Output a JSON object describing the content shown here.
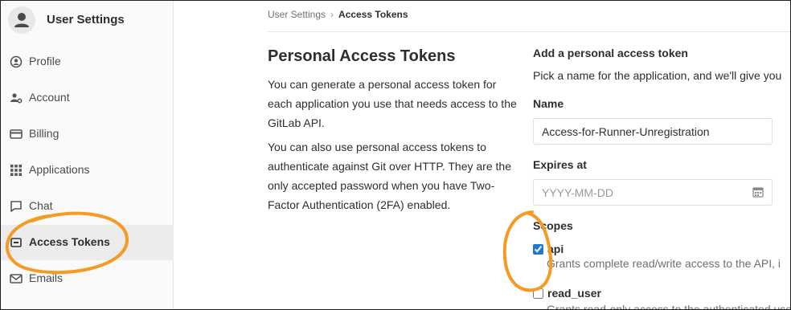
{
  "sidebar": {
    "title": "User Settings",
    "items": [
      {
        "label": "Profile",
        "icon": "user-circle-icon",
        "active": false
      },
      {
        "label": "Account",
        "icon": "user-gear-icon",
        "active": false
      },
      {
        "label": "Billing",
        "icon": "credit-card-icon",
        "active": false
      },
      {
        "label": "Applications",
        "icon": "grid-icon",
        "active": false
      },
      {
        "label": "Chat",
        "icon": "chat-icon",
        "active": false
      },
      {
        "label": "Access Tokens",
        "icon": "token-icon",
        "active": true
      },
      {
        "label": "Emails",
        "icon": "envelope-icon",
        "active": false
      }
    ]
  },
  "breadcrumb": {
    "parent": "User Settings",
    "separator": "›",
    "current": "Access Tokens"
  },
  "intro": {
    "title": "Personal Access Tokens",
    "paragraph1": "You can generate a personal access token for each application you use that needs access to the GitLab API.",
    "paragraph2": "You can also use personal access tokens to authenticate against Git over HTTP. They are the only accepted password when you have Two-Factor Authentication (2FA) enabled."
  },
  "form": {
    "heading": "Add a personal access token",
    "description": "Pick a name for the application, and we'll give you",
    "name_label": "Name",
    "name_value": "Access-for-Runner-Unregistration",
    "expires_label": "Expires at",
    "expires_placeholder": "YYYY-MM-DD",
    "scopes_label": "Scopes",
    "scopes": [
      {
        "name": "api",
        "checked": true,
        "description": "Grants complete read/write access to the API, i"
      },
      {
        "name": "read_user",
        "checked": false,
        "description": "Grants read-only access to the authenticated user"
      }
    ]
  },
  "colors": {
    "annotation": "#f59a23",
    "checkbox_accent": "#1f78d1"
  }
}
